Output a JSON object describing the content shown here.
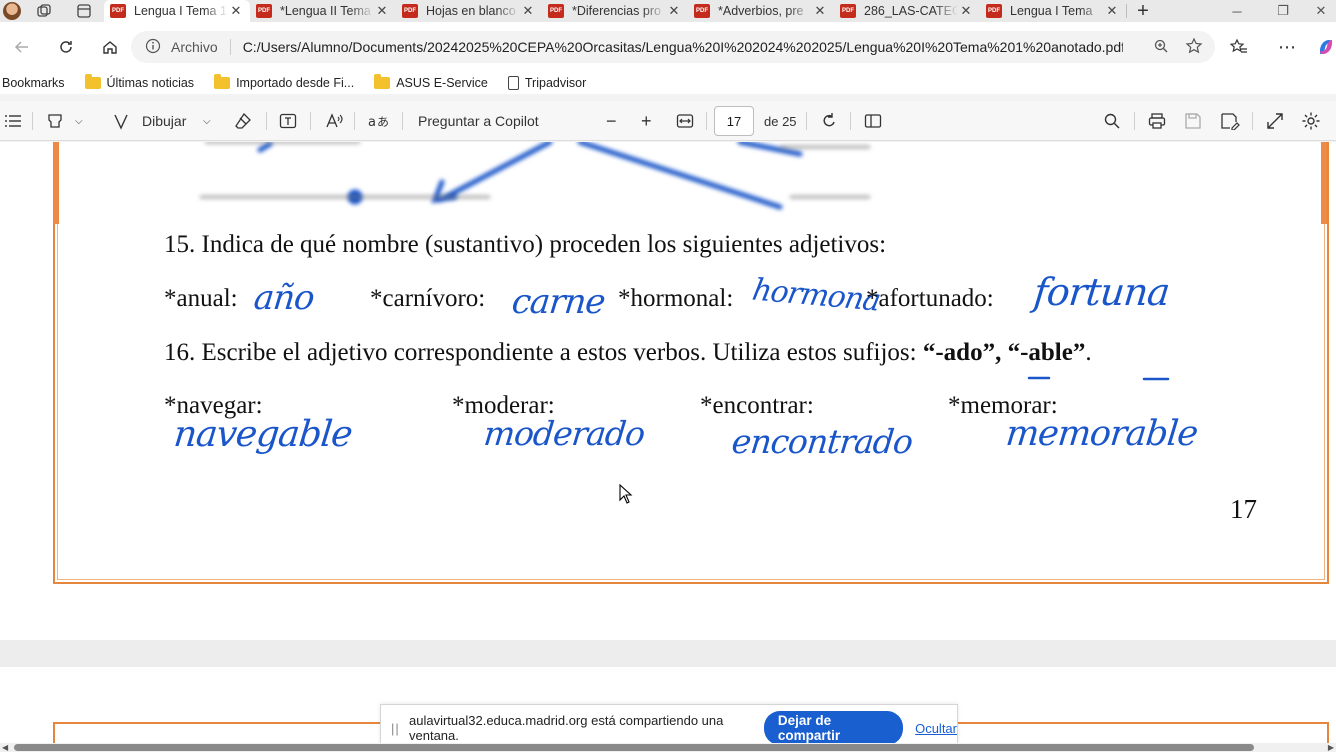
{
  "tabs": [
    {
      "title": "Lengua I Tema 1",
      "active": true
    },
    {
      "title": "*Lengua II Tema",
      "active": false
    },
    {
      "title": "Hojas en blanco",
      "active": false
    },
    {
      "title": "*Diferencias pro",
      "active": false
    },
    {
      "title": "*Adverbios, pre",
      "active": false
    },
    {
      "title": "286_LAS-CATEG",
      "active": false
    },
    {
      "title": "Lengua I Tema",
      "active": false
    }
  ],
  "address": {
    "scheme": "Archivo",
    "url": "C:/Users/Alumno/Documents/20242025%20CEPA%20Orcasitas/Lengua%20I%202024%202025/Lengua%20I%20Tema%201%20anotado.pdf"
  },
  "bookmarks": [
    {
      "label": "Bookmarks",
      "icon": "none"
    },
    {
      "label": "Últimas noticias",
      "icon": "folder"
    },
    {
      "label": "Importado desde Fi...",
      "icon": "folder"
    },
    {
      "label": "ASUS E-Service",
      "icon": "folder"
    },
    {
      "label": "Tripadvisor",
      "icon": "page"
    }
  ],
  "pdf_toolbar": {
    "draw_label": "Dibujar",
    "copilot_label": "Preguntar a Copilot",
    "current_page": "17",
    "page_total": "de 25"
  },
  "document": {
    "q15": "15. Indica de qué nombre (sustantivo) proceden los siguientes adjetivos:",
    "row15": {
      "w1": "*anual:",
      "a1": "año",
      "w2": "*carnívoro:",
      "a2": "carne",
      "w3": "*hormonal:",
      "a3": "hormona",
      "w4": "*afortunado:",
      "a4": "fortuna"
    },
    "q16_pre": "16. Escribe el adjetivo correspondiente a estos verbos. Utiliza estos sufijos:",
    "q16_suffix1": "“-ado”",
    "q16_comma": ",",
    "q16_suffix2": "“-able”",
    "q16_end": ".",
    "row16": {
      "w1": "*navegar:",
      "a1": "navegable",
      "w2": "*moderar:",
      "a2": "moderado",
      "w3": "*encontrar:",
      "a3": "encontrado",
      "w4": "*memorar:",
      "a4": "memorable"
    },
    "page_number": "17"
  },
  "share_banner": {
    "message": "aulavirtual32.educa.madrid.org está compartiendo una ventana.",
    "stop_label": "Dejar de compartir",
    "hide_label": "Ocultar"
  },
  "colors": {
    "ink": "#1a56c9",
    "frame": "#e6863c",
    "share_button": "#1a5fd0"
  }
}
